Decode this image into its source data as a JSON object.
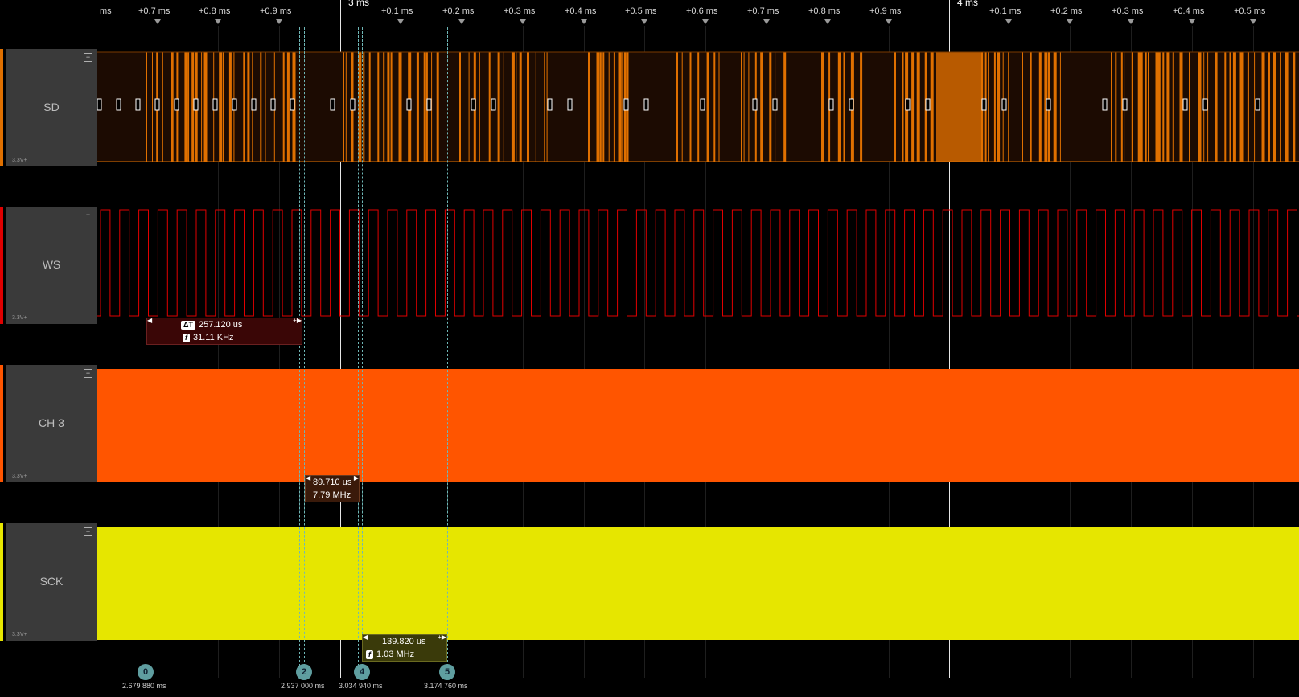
{
  "ruler": {
    "ticks": [
      {
        "label": "ms"
      },
      {
        "label": "+0.7 ms"
      },
      {
        "label": "+0.8 ms"
      },
      {
        "label": "+0.9 ms"
      },
      {
        "label": "+0.1 ms"
      },
      {
        "label": "+0.2 ms"
      },
      {
        "label": "+0.3 ms"
      },
      {
        "label": "+0.4 ms"
      },
      {
        "label": "+0.5 ms"
      },
      {
        "label": "+0.6 ms"
      },
      {
        "label": "+0.7 ms"
      },
      {
        "label": "+0.8 ms"
      },
      {
        "label": "+0.9 ms"
      },
      {
        "label": "+0.1 ms"
      },
      {
        "label": "+0.2 ms"
      },
      {
        "label": "+0.3 ms"
      },
      {
        "label": "+0.4 ms"
      },
      {
        "label": "+0.5 ms"
      }
    ],
    "major": [
      {
        "label": "3 ms"
      },
      {
        "label": "4 ms"
      }
    ]
  },
  "channels": [
    {
      "name": "SD",
      "voltage": "3.3V+",
      "color": "#e07000",
      "fill": "#1c0b02"
    },
    {
      "name": "WS",
      "voltage": "3.3V+",
      "color": "#e00000"
    },
    {
      "name": "CH 3",
      "voltage": "3.3V+",
      "color": "#ff5500"
    },
    {
      "name": "SCK",
      "voltage": "3.3V+",
      "color": "#e6e600"
    }
  ],
  "measurements": [
    {
      "dt": "257.120 us",
      "freq": "31.11 KHz",
      "dt_badge": "ΔT",
      "freq_badge": "f",
      "bg": "#3a0606"
    },
    {
      "dt": "89.710 us",
      "freq": "7.79 MHz",
      "bg": "#3a1a0a"
    },
    {
      "dt": "139.820 us",
      "freq": "1.03 MHz",
      "freq_badge": "f",
      "bg": "#3a3a0a"
    }
  ],
  "cursors": [
    {
      "label": "0",
      "time": "2.679 880 ms"
    },
    {
      "label": "2",
      "time": "2.937 000 ms"
    },
    {
      "label": "4",
      "time": "3.034 940 ms"
    },
    {
      "label": "5",
      "time": "3.174 760 ms"
    }
  ]
}
